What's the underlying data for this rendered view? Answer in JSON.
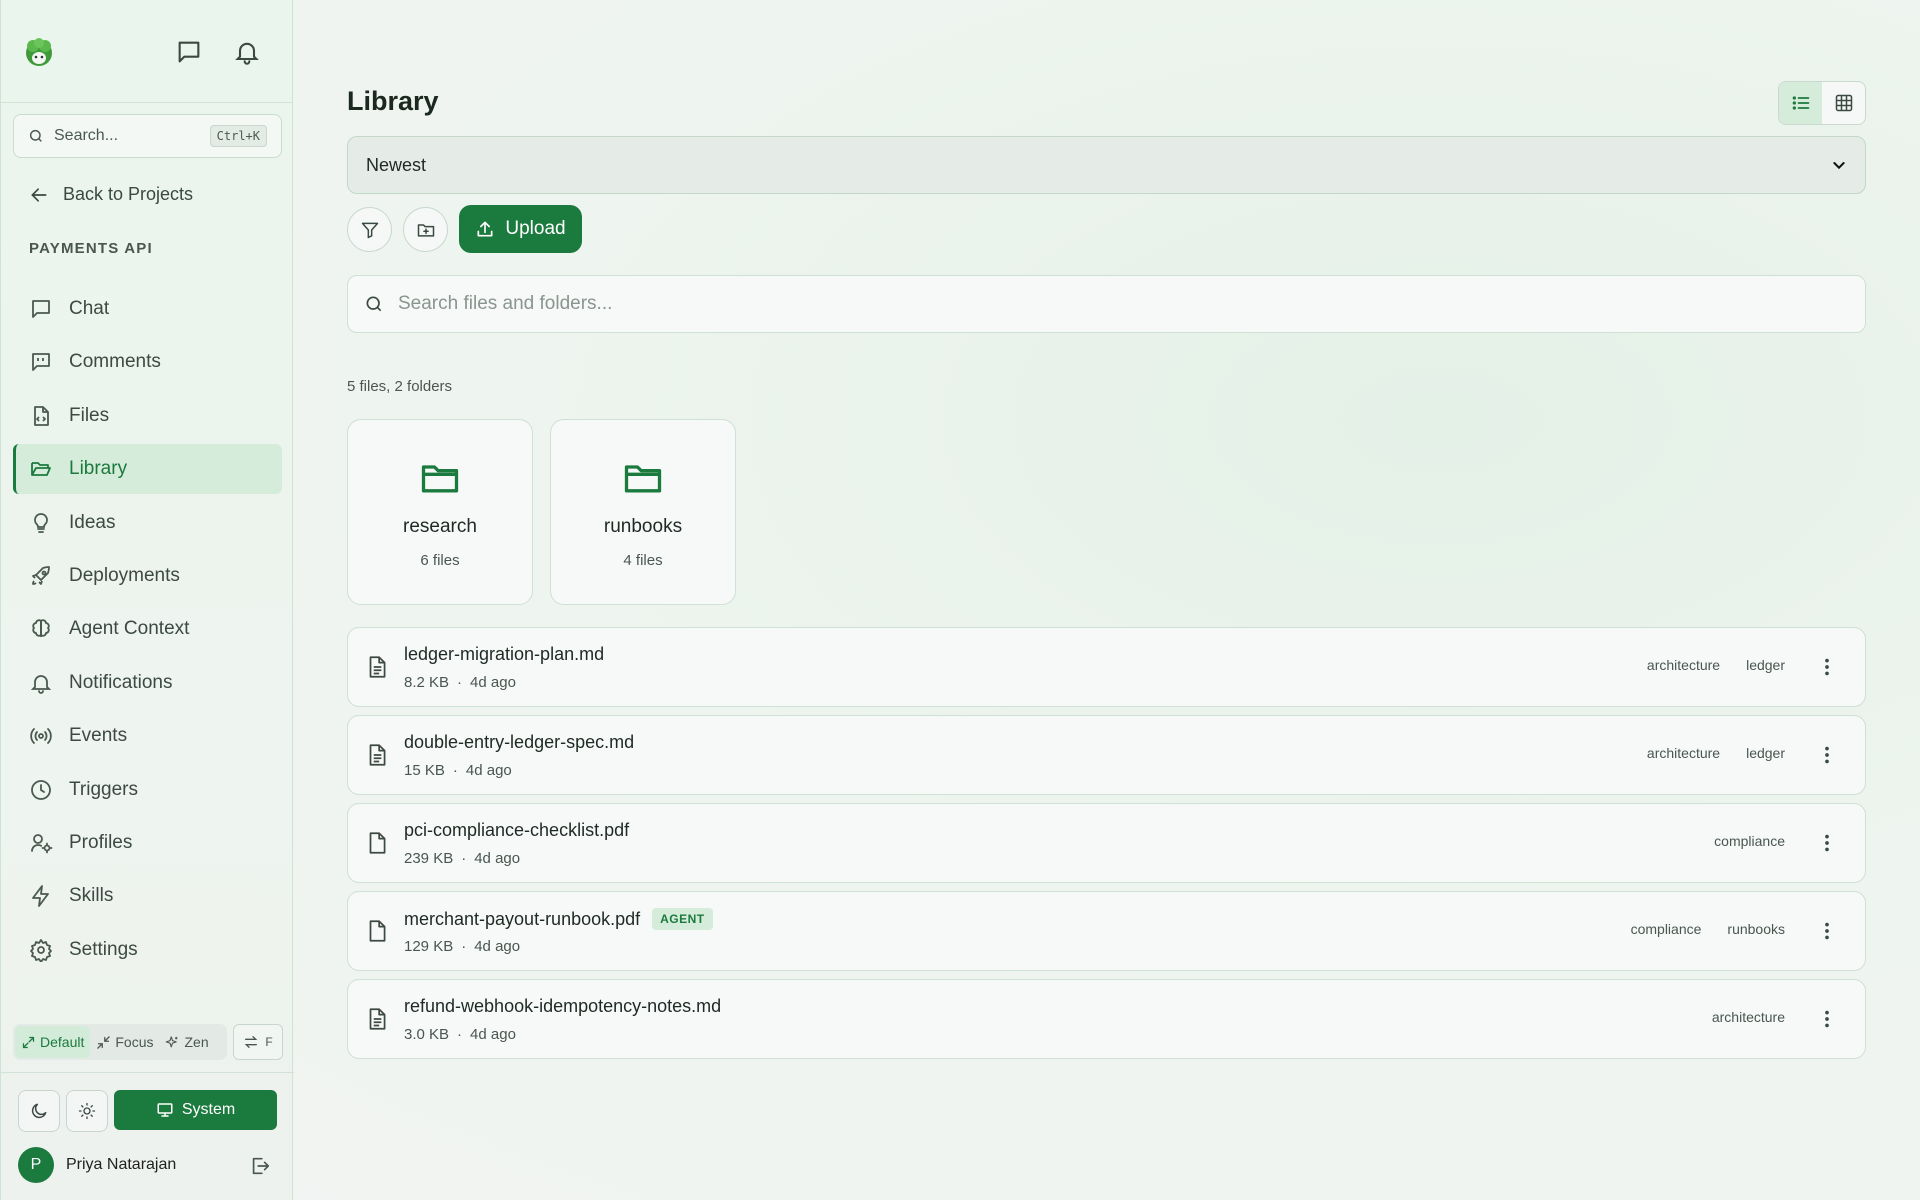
{
  "sidebar": {
    "search_placeholder": "Search...",
    "search_shortcut": "Ctrl+K",
    "back_label": "Back to Projects",
    "project_name": "PAYMENTS API",
    "nav": [
      {
        "label": "Chat",
        "icon": "chat-icon"
      },
      {
        "label": "Comments",
        "icon": "comments-icon"
      },
      {
        "label": "Files",
        "icon": "file-code-icon"
      },
      {
        "label": "Library",
        "icon": "folder-open-icon",
        "active": true
      },
      {
        "label": "Ideas",
        "icon": "lightbulb-icon"
      },
      {
        "label": "Deployments",
        "icon": "rocket-icon"
      },
      {
        "label": "Agent Context",
        "icon": "brain-icon"
      },
      {
        "label": "Notifications",
        "icon": "bell-icon"
      },
      {
        "label": "Events",
        "icon": "broadcast-icon"
      },
      {
        "label": "Triggers",
        "icon": "clock-icon"
      },
      {
        "label": "Profiles",
        "icon": "user-cog-icon"
      },
      {
        "label": "Skills",
        "icon": "lightning-icon"
      },
      {
        "label": "Settings",
        "icon": "gear-icon"
      }
    ],
    "modes": {
      "default": "Default",
      "focus": "Focus",
      "zen": "Zen",
      "swap_key": "F"
    },
    "theme": {
      "system_label": "System"
    },
    "user": {
      "initial": "P",
      "name": "Priya Natarajan"
    }
  },
  "main": {
    "title": "Library",
    "sort_value": "Newest",
    "upload_label": "Upload",
    "search_placeholder": "Search files and folders...",
    "count_text": "5 files, 2 folders",
    "folders": [
      {
        "name": "research",
        "count": "6 files"
      },
      {
        "name": "runbooks",
        "count": "4 files"
      }
    ],
    "files": [
      {
        "name": "ledger-migration-plan.md",
        "size": "8.2 KB",
        "age": "4d ago",
        "tags": [
          "architecture",
          "ledger"
        ],
        "type": "doc"
      },
      {
        "name": "double-entry-ledger-spec.md",
        "size": "15 KB",
        "age": "4d ago",
        "tags": [
          "architecture",
          "ledger"
        ],
        "type": "doc"
      },
      {
        "name": "pci-compliance-checklist.pdf",
        "size": "239 KB",
        "age": "4d ago",
        "tags": [
          "compliance"
        ],
        "type": "blank"
      },
      {
        "name": "merchant-payout-runbook.pdf",
        "size": "129 KB",
        "age": "4d ago",
        "tags": [
          "compliance",
          "runbooks"
        ],
        "type": "blank",
        "badge": "AGENT"
      },
      {
        "name": "refund-webhook-idempotency-notes.md",
        "size": "3.0 KB",
        "age": "4d ago",
        "tags": [
          "architecture"
        ],
        "type": "doc"
      }
    ]
  },
  "colors": {
    "accent": "#1b7a3d",
    "accent_soft": "#d6ecdb"
  }
}
